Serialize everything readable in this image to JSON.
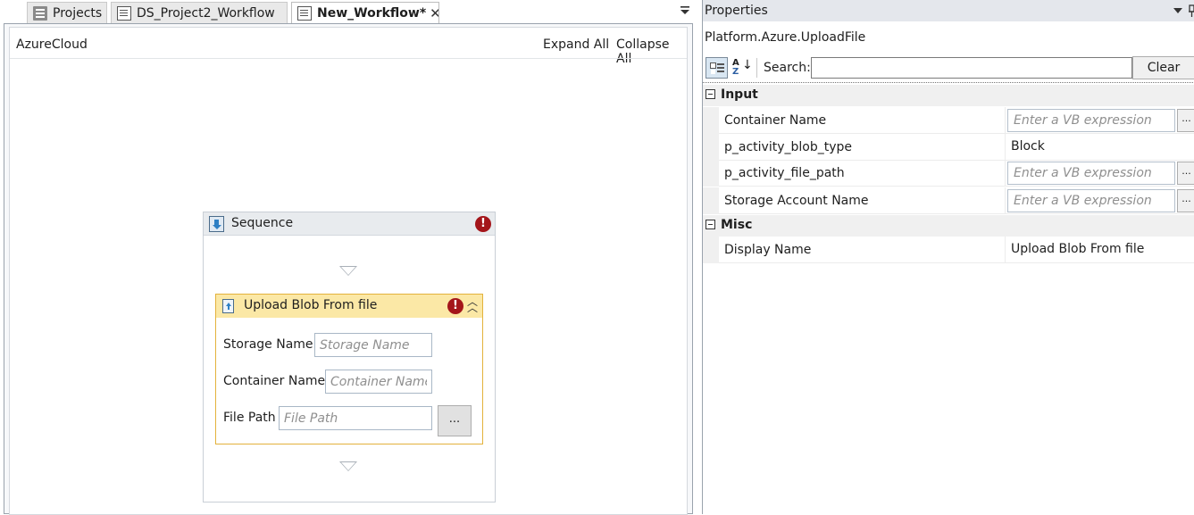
{
  "tabs": [
    {
      "label": "Projects",
      "icon": "project-icon"
    },
    {
      "label": "DS_Project2_Workflow",
      "icon": "document-icon"
    },
    {
      "label": "New_Workflow*",
      "icon": "document-icon",
      "close": "✕"
    }
  ],
  "designer": {
    "breadcrumb": "AzureCloud",
    "expand_all": "Expand All",
    "collapse_all": "Collapse All",
    "sequence": {
      "title": "Sequence",
      "error_mark": "!",
      "activity": {
        "title": "Upload Blob From file",
        "error_mark": "!",
        "fields": {
          "storage_name": {
            "label": "Storage Name",
            "placeholder": "Storage Name"
          },
          "container_name": {
            "label": "Container Name",
            "placeholder": "Container Name"
          },
          "file_path": {
            "label": "File Path",
            "placeholder": "File Path"
          }
        },
        "browse_label": "..."
      }
    }
  },
  "properties": {
    "title": "Properties",
    "type_name": "Platform.Azure.UploadFile",
    "toolbar": {
      "alpha_top": "A",
      "alpha_bottom": "Z",
      "search_label": "Search:",
      "clear_label": "Clear"
    },
    "categories": {
      "input": {
        "name": "Input",
        "rows": {
          "container_name": {
            "name": "Container Name",
            "placeholder": "Enter a VB expression",
            "button": "..."
          },
          "blob_type": {
            "name": "p_activity_blob_type",
            "value": "Block"
          },
          "file_path": {
            "name": "p_activity_file_path",
            "placeholder": "Enter a VB expression",
            "button": "..."
          },
          "storage_account": {
            "name": "Storage Account Name",
            "placeholder": "Enter a VB expression",
            "button": "..."
          }
        }
      },
      "misc": {
        "name": "Misc",
        "rows": {
          "display_name": {
            "name": "Display Name",
            "value": "Upload Blob From file"
          }
        }
      }
    }
  },
  "colors": {
    "error": "#a4151a",
    "activity_header": "#fbe8a6",
    "activity_border": "#e3b23c"
  }
}
